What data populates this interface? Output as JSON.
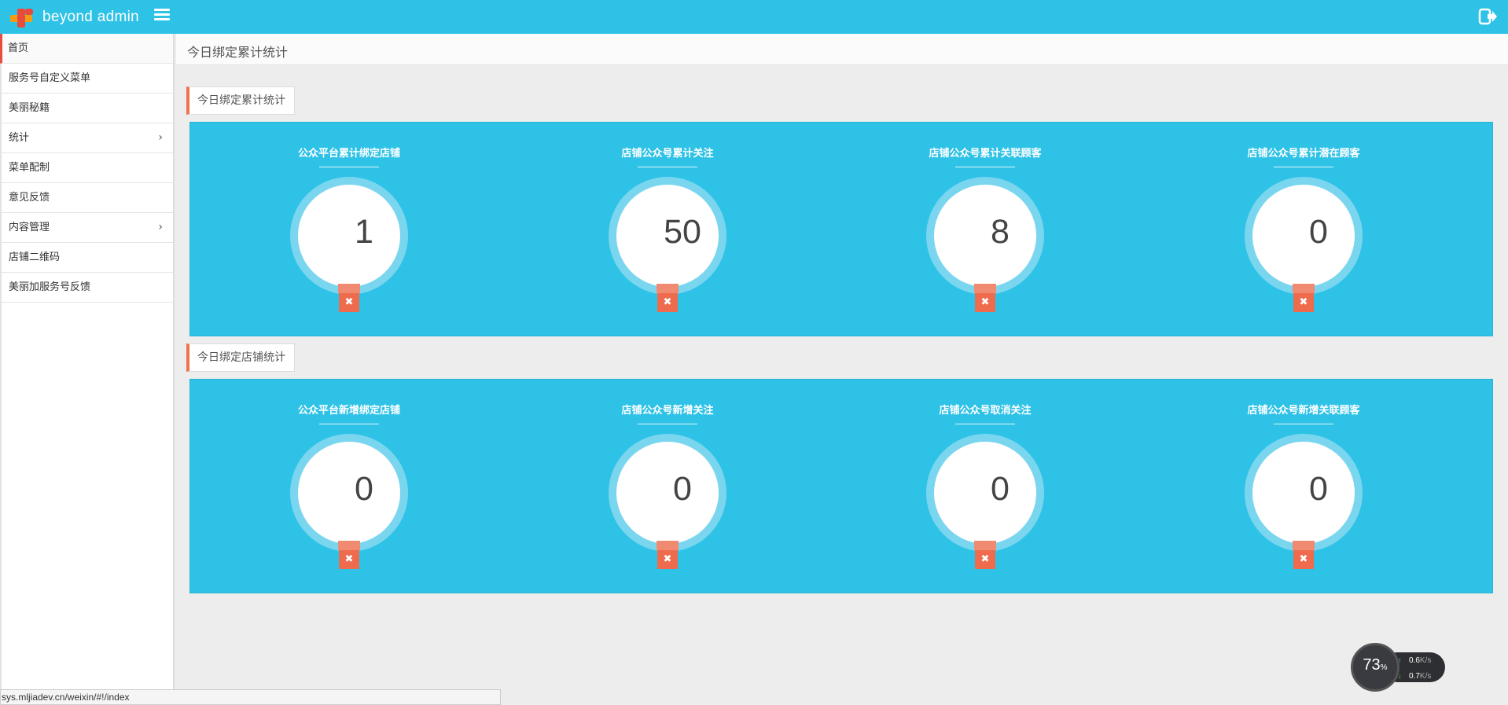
{
  "app": {
    "brand": "beyond admin"
  },
  "colors": {
    "primary": "#2fc2e7",
    "accent": "#ef6b4e"
  },
  "sidebar": {
    "items": [
      {
        "label": "首页"
      },
      {
        "label": "服务号自定义菜单"
      },
      {
        "label": "美丽秘籍"
      },
      {
        "label": "统计",
        "chevron": "›"
      },
      {
        "label": "菜单配制"
      },
      {
        "label": "意见反馈"
      },
      {
        "label": "内容管理",
        "chevron": "›"
      },
      {
        "label": "店铺二维码"
      },
      {
        "label": "美丽加服务号反馈"
      }
    ]
  },
  "header": {
    "title": "今日绑定累计统计"
  },
  "sections": [
    {
      "tab": "今日绑定累计统计",
      "stats": [
        {
          "label": "公众平台累计绑定店铺",
          "value": "1"
        },
        {
          "label": "店铺公众号累计关注",
          "value": "50"
        },
        {
          "label": "店铺公众号累计关联顾客",
          "value": "8"
        },
        {
          "label": "店铺公众号累计潜在顾客",
          "value": "0"
        }
      ]
    },
    {
      "tab": "今日绑定店铺统计",
      "stats": [
        {
          "label": "公众平台新增绑定店铺",
          "value": "0"
        },
        {
          "label": "店铺公众号新增关注",
          "value": "0"
        },
        {
          "label": "店铺公众号取消关注",
          "value": "0"
        },
        {
          "label": "店铺公众号新增关联顾客",
          "value": "0"
        }
      ]
    }
  ],
  "close_glyph": "✖",
  "statusbar": {
    "url": "sys.mljiadev.cn/weixin/#!/index"
  },
  "netspeed": {
    "percent": "73",
    "percent_unit": "%",
    "up_value": "0.6",
    "down_value": "0.7",
    "unit": "K/s",
    "up_arrow": "↑",
    "down_arrow": "↓"
  }
}
